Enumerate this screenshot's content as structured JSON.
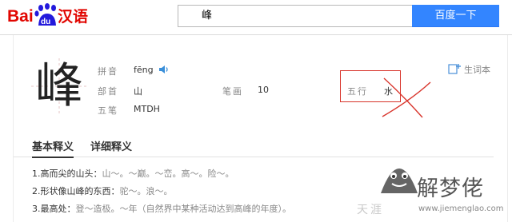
{
  "header": {
    "logo": {
      "brand_letters": "Bai",
      "paw_text": "du",
      "product": "汉语"
    },
    "search": {
      "query": "峰"
    },
    "search_button_label": "百度一下"
  },
  "entry": {
    "character": "峰",
    "fields": {
      "pinyin_label": "拼音",
      "pinyin_value": "fēng",
      "radical_label": "部首",
      "radical_value": "山",
      "strokes_label": "笔画",
      "strokes_value": "10",
      "wubi_label": "五笔",
      "wubi_value": "MTDH",
      "wuxing_label": "五行",
      "wuxing_value": "水"
    },
    "vocab_link_label": "生词本"
  },
  "tabs": [
    {
      "label": "基本释义",
      "active": true
    },
    {
      "label": "详细释义",
      "active": false
    }
  ],
  "definitions": [
    {
      "text": "1.高而尖的山头：",
      "examples": "山～。～巅。～峦。高～。险～。"
    },
    {
      "text": "2.形状像山峰的东西：",
      "examples": "驼～。浪～。"
    },
    {
      "text": "3.最高处：",
      "examples": "登～造极。～年（自然界中某种活动达到高峰的年度）。"
    }
  ],
  "watermark": {
    "name": "解梦佬",
    "url": "www.jiemenglao.com",
    "faint_text": "天涯"
  },
  "colors": {
    "accent_blue": "#3385ff",
    "annotation_red": "#d8332a",
    "logo_red": "#e10601",
    "logo_blue": "#2319dc"
  }
}
